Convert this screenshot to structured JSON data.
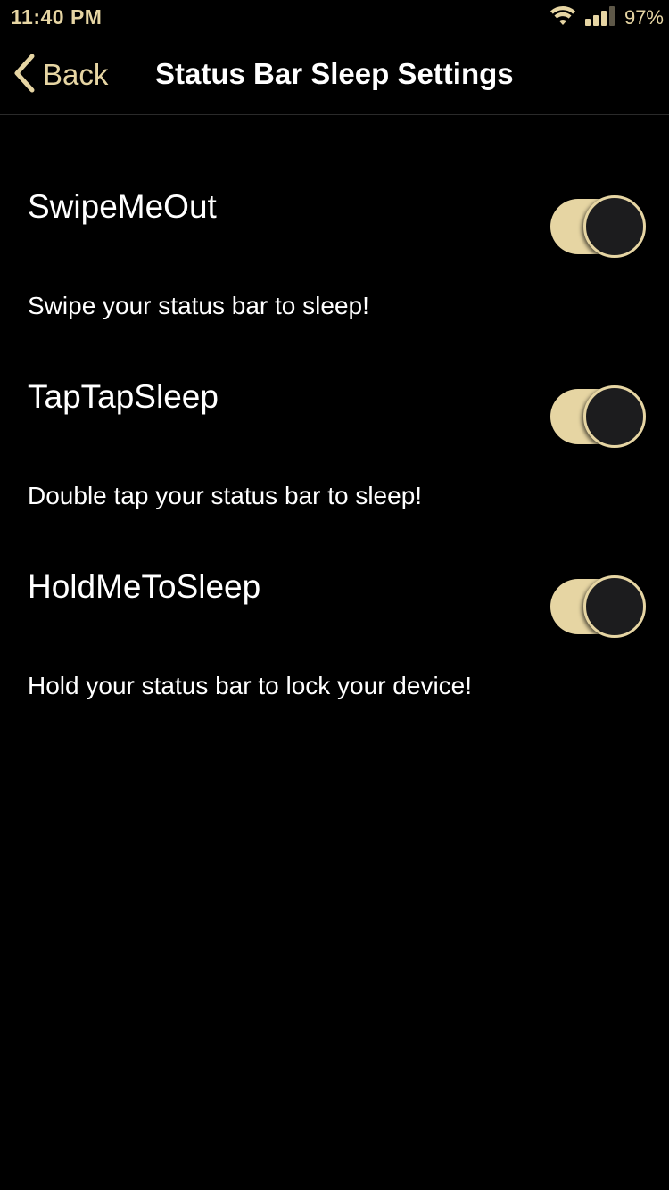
{
  "status_bar": {
    "time": "11:40 PM",
    "battery": "97%",
    "icons": [
      "wifi-icon",
      "signal-icon"
    ]
  },
  "nav": {
    "back_label": "Back",
    "title": "Status Bar Sleep Settings"
  },
  "settings": [
    {
      "title": "SwipeMeOut",
      "description": "Swipe your status bar to sleep!",
      "enabled": true
    },
    {
      "title": "TapTapSleep",
      "description": "Double tap your status bar to sleep!",
      "enabled": true
    },
    {
      "title": "HoldMeToSleep",
      "description": "Hold your status bar to lock your device!",
      "enabled": true
    }
  ],
  "colors": {
    "accent": "#e6d5a3",
    "background": "#000000",
    "text": "#ffffff",
    "knob": "#1c1c1e"
  }
}
